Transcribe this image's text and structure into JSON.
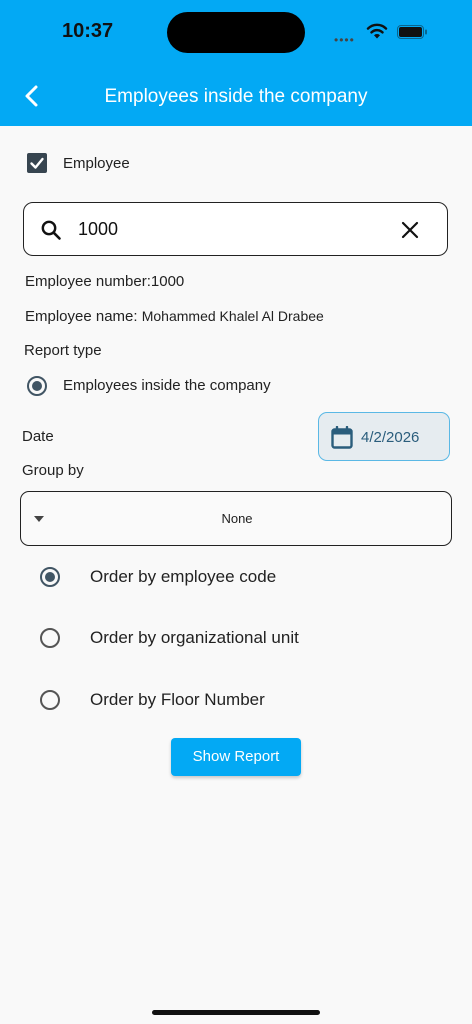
{
  "status_bar": {
    "time": "10:37"
  },
  "header": {
    "title": "Employees inside the company"
  },
  "employee_checkbox": {
    "label": "Employee",
    "checked": true
  },
  "search": {
    "value": "1000"
  },
  "employee_info": {
    "number_label": "Employee number:",
    "number_value": "1000",
    "name_label": "Employee name: ",
    "name_value": "Mohammed Khalel Al Drabee"
  },
  "report_type": {
    "label": "Report type",
    "options": [
      {
        "label": "Employees inside the company",
        "selected": true
      }
    ]
  },
  "date": {
    "label": "Date",
    "value": "4/2/2026"
  },
  "group_by": {
    "label": "Group by",
    "selected": "None"
  },
  "order_options": [
    {
      "label": "Order by employee code",
      "selected": true
    },
    {
      "label": "Order by organizational unit",
      "selected": false
    },
    {
      "label": "Order by Floor Number",
      "selected": false
    }
  ],
  "show_report_button": {
    "label": "Show Report"
  },
  "colors": {
    "accent": "#03a9f4",
    "radio_selected": "#415564",
    "date_button_bg": "#e6ecf0"
  }
}
